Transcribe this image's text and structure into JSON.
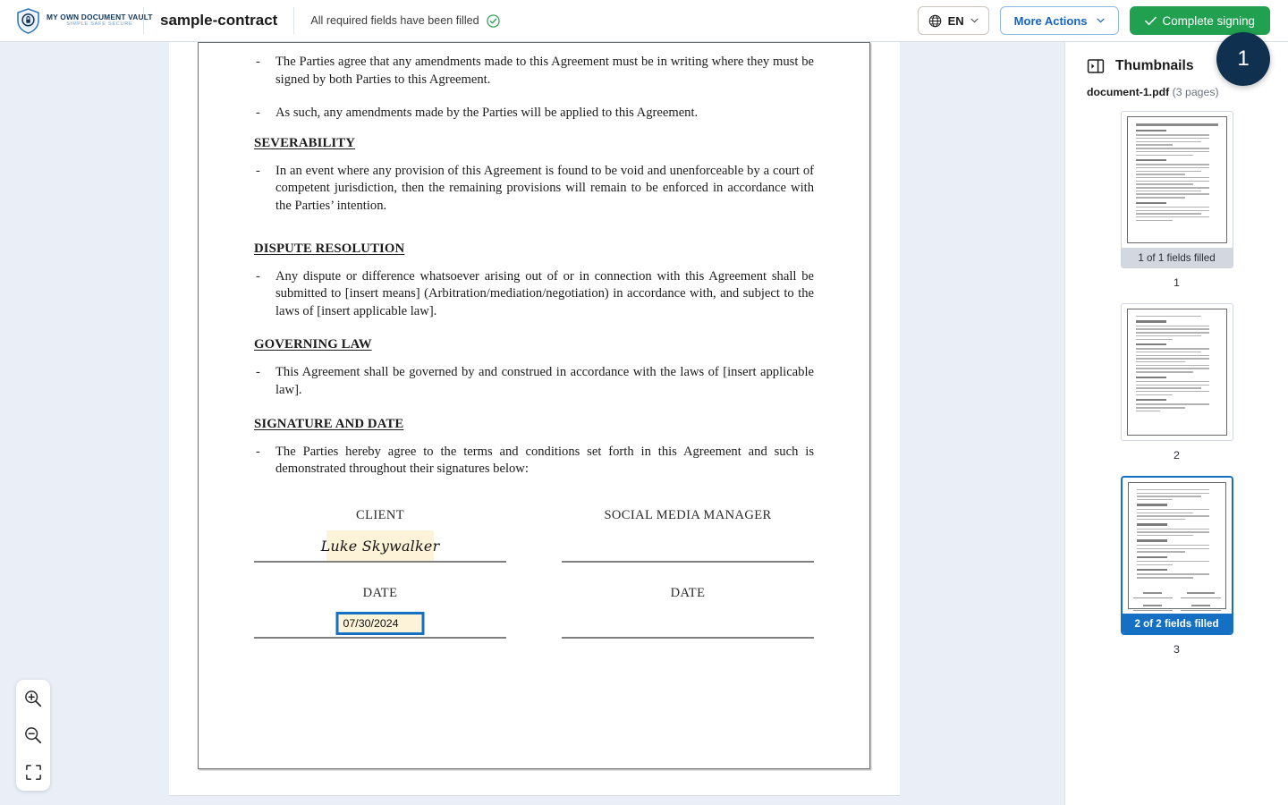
{
  "header": {
    "logo": {
      "icon": "shield-lock-icon",
      "title": "MY OWN DOCUMENT VAULT",
      "tagline": "SIMPLE SAFE SECURE"
    },
    "document_name": "sample-contract",
    "status_text": "All required fields have been filled",
    "status_icon": "check-circle-icon",
    "language_button": {
      "icon": "globe-icon",
      "label": "EN",
      "caret": "chevron-down-icon"
    },
    "more_actions_button": {
      "label": "More Actions",
      "caret": "chevron-down-icon"
    },
    "complete_button": {
      "icon": "check-icon",
      "label": "Complete signing"
    },
    "accent_green": "#21a150",
    "accent_blue": "#1565c0"
  },
  "step_badge": {
    "label": "1",
    "color": "#10304f"
  },
  "document": {
    "blocks": [
      {
        "kind": "bullet",
        "dash": "-",
        "text": "The Parties agree that any amendments made to this Agreement must be in writing where they must be signed by both Parties to this Agreement."
      },
      {
        "kind": "bullet",
        "dash": "-",
        "text": "As such, any amendments made by the Parties will be applied to this Agreement."
      },
      {
        "kind": "heading",
        "text": "SEVERABILITY"
      },
      {
        "kind": "bullet",
        "dash": "-",
        "text": "In an event where any provision of this Agreement is found to be void and unenforceable by a court of competent jurisdiction, then the remaining provisions will remain to be enforced in accordance with the Parties’ intention."
      },
      {
        "kind": "heading",
        "text": "DISPUTE RESOLUTION"
      },
      {
        "kind": "bullet",
        "dash": "-",
        "text": "Any dispute or difference whatsoever arising out of or in connection with this Agreement shall be submitted to [insert means] (Arbitration/mediation/negotiation) in accordance with, and subject to the laws of [insert applicable law]."
      },
      {
        "kind": "heading",
        "text": "GOVERNING LAW"
      },
      {
        "kind": "bullet",
        "dash": "-",
        "text": "This Agreement shall be governed by and construed in accordance with the laws of [insert applicable law]."
      },
      {
        "kind": "heading",
        "text": "SIGNATURE AND DATE"
      },
      {
        "kind": "bullet",
        "dash": "-",
        "text": "The Parties hereby agree to the terms and conditions set forth in this Agreement and such is demonstrated throughout their signatures below:"
      }
    ],
    "signature_block": {
      "left": {
        "party_label": "CLIENT",
        "signature_value": "Luke Skywalker",
        "date_label": "DATE",
        "date_value": "07/30/2024"
      },
      "right": {
        "party_label": "SOCIAL MEDIA MANAGER",
        "signature_value": "",
        "date_label": "DATE",
        "date_value": ""
      },
      "field_fill_color": "#fdf3d8",
      "active_field_border": "#1570c4"
    }
  },
  "zoom_controls": [
    {
      "name": "zoom-in-icon"
    },
    {
      "name": "zoom-out-icon"
    },
    {
      "name": "fit-screen-icon"
    }
  ],
  "thumbnails_panel": {
    "icon": "panel-toggle-icon",
    "title": "Thumbnails",
    "file_name": "document-1.pdf",
    "page_count_text": "(3 pages)",
    "pages": [
      {
        "number": "1",
        "badge": "1 of 1 fields filled",
        "badge_active": false,
        "selected": false
      },
      {
        "number": "2",
        "badge": "",
        "badge_active": false,
        "selected": false
      },
      {
        "number": "3",
        "badge": "2 of 2 fields filled",
        "badge_active": true,
        "selected": true
      }
    ]
  }
}
